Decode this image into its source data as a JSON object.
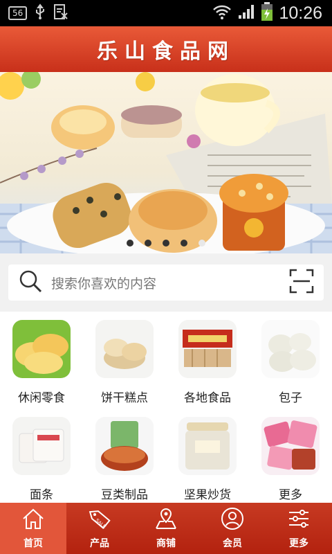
{
  "statusbar": {
    "badge": "56",
    "time": "10:26",
    "icons": [
      "usb-icon",
      "notification-icon",
      "wifi-icon",
      "signal-icon",
      "battery-charging-icon"
    ]
  },
  "header": {
    "title": "乐山食品网"
  },
  "banner": {
    "slide_count": 5,
    "active_slide": 5
  },
  "search": {
    "placeholder": "搜索你喜欢的内容"
  },
  "categories": [
    {
      "label": "休闲零食",
      "icon": "snacks-thumb"
    },
    {
      "label": "饼干糕点",
      "icon": "pastry-thumb"
    },
    {
      "label": "各地食品",
      "icon": "local-food-thumb"
    },
    {
      "label": "包子",
      "icon": "buns-thumb"
    },
    {
      "label": "面条",
      "icon": "noodles-thumb"
    },
    {
      "label": "豆类制品",
      "icon": "bean-products-thumb"
    },
    {
      "label": "坚果炒货",
      "icon": "nuts-thumb"
    },
    {
      "label": "更多",
      "icon": "more-thumb"
    }
  ],
  "tabs": [
    {
      "label": "首页",
      "icon": "home-icon",
      "active": true
    },
    {
      "label": "产品",
      "icon": "sale-tag-icon",
      "active": false
    },
    {
      "label": "商铺",
      "icon": "map-icon",
      "active": false
    },
    {
      "label": "会员",
      "icon": "user-icon",
      "active": false
    },
    {
      "label": "更多",
      "icon": "sliders-icon",
      "active": false
    }
  ],
  "colors": {
    "brand_red": "#c8301a",
    "active_tab": "#e2563a"
  }
}
